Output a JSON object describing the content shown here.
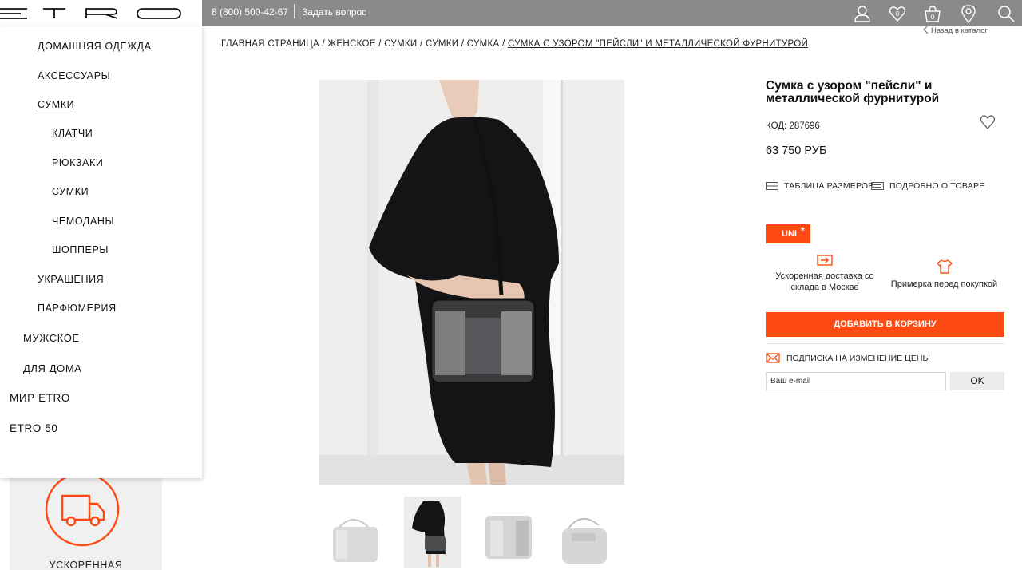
{
  "header": {
    "logo": "ETRO",
    "phone": "8 (800) 500-42-67",
    "ask_question": "Задать вопрос",
    "wishlist_count": "0",
    "cart_count": "0"
  },
  "sidebar": {
    "items": [
      {
        "label": "Домашняя одежда"
      },
      {
        "label": "Аксессуары"
      },
      {
        "label": "Сумки"
      },
      {
        "label": "Клатчи"
      },
      {
        "label": "Рюкзаки"
      },
      {
        "label": "Сумки"
      },
      {
        "label": "Чемоданы"
      },
      {
        "label": "Шопперы"
      },
      {
        "label": "Украшения"
      },
      {
        "label": "Парфюмерия"
      },
      {
        "label": "Мужское"
      },
      {
        "label": "Для дома"
      },
      {
        "label": "Мир ETRO"
      },
      {
        "label": "ETRO 50"
      }
    ],
    "promo_text": "УСКОРЕННАЯ"
  },
  "breadcrumb": {
    "items": [
      "ГЛАВНАЯ СТРАНИЦА",
      "ЖЕНСКОЕ",
      "СУМКИ",
      "СУМКИ",
      "СУМКА"
    ],
    "separator": " / ",
    "current": "СУМКА С УЗОРОМ \"ПЕЙСЛИ\" И МЕТАЛЛИЧЕСКОЙ ФУРНИТУРОЙ",
    "back_link": "Назад в каталог"
  },
  "product": {
    "title": "Сумка с узором \"пейсли\" и металлической фурнитурой",
    "code": "КОД: 287696",
    "price": "63 750 РУБ",
    "size_table": "ТАБЛИЦА РАЗМЕРОВ",
    "details": "ПОДРОБНО О ТОВАРЕ",
    "size": "UNI",
    "size_mark": "*",
    "features": [
      {
        "text": "Ускоренная доставка со склада в Москве",
        "icon": "delivery-arrow-icon"
      },
      {
        "text": "Примерка перед покупкой",
        "icon": "tshirt-icon"
      }
    ],
    "add_to_cart": "ДОБАВИТЬ В КОРЗИНУ",
    "subscribe_label": "ПОДПИСКА НА ИЗМЕНЕНИЕ ЦЕНЫ",
    "email_placeholder": "Ваш e-mail",
    "ok": "OK"
  },
  "colors": {
    "accent": "#fd4a12",
    "topbar": "#8a8a8a"
  }
}
